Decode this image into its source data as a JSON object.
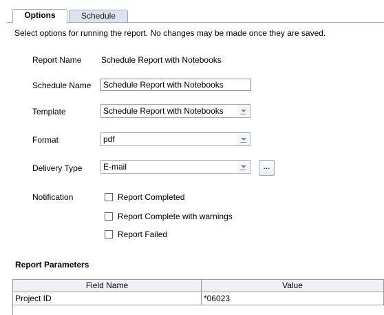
{
  "tabs": {
    "options": "Options",
    "schedule": "Schedule"
  },
  "description": "Select options for running the report. No changes may be made once they are saved.",
  "report_name": {
    "label": "Report Name",
    "value": "Schedule Report with Notebooks"
  },
  "schedule_name": {
    "label": "Schedule Name",
    "value": "Schedule Report with Notebooks"
  },
  "template": {
    "label": "Template",
    "value": "Schedule Report with Notebooks"
  },
  "format": {
    "label": "Format",
    "value": "pdf"
  },
  "delivery_type": {
    "label": "Delivery Type",
    "value": "E-mail",
    "button": "..."
  },
  "notification": {
    "label": "Notification",
    "options": [
      {
        "label": "Report Completed",
        "checked": false
      },
      {
        "label": "Report Complete with warnings",
        "checked": false
      },
      {
        "label": "Report Failed",
        "checked": false
      }
    ]
  },
  "report_parameters": {
    "title": "Report Parameters",
    "columns": [
      "Field Name",
      "Value"
    ],
    "rows": [
      {
        "field": "Project ID",
        "value": "*06023"
      }
    ]
  }
}
